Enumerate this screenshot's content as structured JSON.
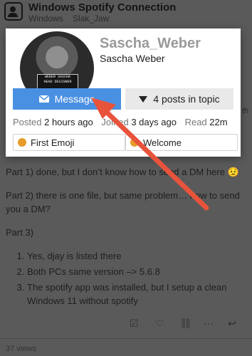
{
  "thread": {
    "title": "Windows Spotify Connection",
    "tags": [
      "Windows",
      "Slak_Jaw"
    ],
    "ghost_right": "th"
  },
  "card": {
    "username": "Sascha_Weber",
    "full_name": "Sascha Weber",
    "message_label": "Message",
    "posts_label": "4 posts in topic",
    "stats": {
      "posted_label": "Posted",
      "posted_value": "2 hours ago",
      "joined_label": "Joined",
      "joined_value": "3 days ago",
      "read_label": "Read",
      "read_value": "22m"
    },
    "badges": [
      "First Emoji",
      "Welcome"
    ],
    "avatar_sign": [
      "WEBER SASCHA",
      "HEAD DESIGNER"
    ]
  },
  "post": {
    "part1": "Part 1) done, but I don’t know how to send a DM here 😟",
    "part2": "Part 2) there is one file, but same problem… how to send you a DM?",
    "part3": "Part 3)",
    "list": [
      "Yes, djay is listed there",
      "Both PCs same version –> 5.6.8",
      "The spotify app was installed, but I setup a clean Windows 11 without spotify"
    ]
  },
  "footer": {
    "views": "37 views"
  },
  "icons": {
    "message": "envelope-icon",
    "posts": "filter-icon",
    "arrow": "red-arrow-annotation"
  },
  "colors": {
    "message_button": "#4a90e2",
    "annotation_arrow": "#e8533b"
  }
}
